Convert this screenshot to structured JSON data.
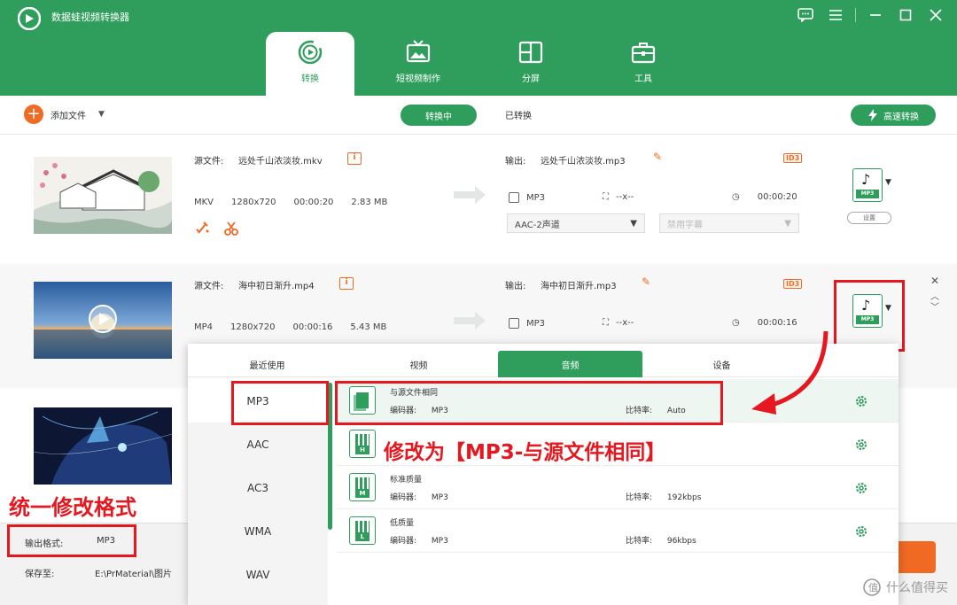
{
  "app": {
    "title": "数据蛙视频转换器",
    "brand_color": "#2f9e5c",
    "accent_color": "#f06a24",
    "window_controls": [
      "feedback-icon",
      "menu-icon",
      "minimize-icon",
      "maximize-icon",
      "close-icon"
    ]
  },
  "tabs": [
    {
      "label": "转换",
      "icon": "convert-icon",
      "active": true
    },
    {
      "label": "短视频制作",
      "icon": "tv-icon",
      "active": false
    },
    {
      "label": "分屏",
      "icon": "split-screen-icon",
      "active": false
    },
    {
      "label": "工具",
      "icon": "toolbox-icon",
      "active": false
    }
  ],
  "toolbar": {
    "add_file": "添加文件",
    "converting": "转换中",
    "converted": "已转换",
    "fast_convert": "高速转换"
  },
  "files": [
    {
      "source_label": "源文件:",
      "source_name": "远处千山浓淡妆.mkv",
      "format": "MKV",
      "resolution": "1280x720",
      "duration": "00:00:20",
      "size": "2.83 MB",
      "output_label": "输出:",
      "output_name": "远处千山浓淡妆.mp3",
      "out_format": "MP3",
      "out_resolution": "--x--",
      "out_duration": "00:00:20",
      "audio_track": "AAC-2声道",
      "subtitle": "禁用字幕",
      "settings_label": "设置"
    },
    {
      "source_label": "源文件:",
      "source_name": "海中初日渐升.mp4",
      "format": "MP4",
      "resolution": "1280x720",
      "duration": "00:00:16",
      "size": "5.43 MB",
      "output_label": "输出:",
      "output_name": "海中初日渐升.mp3",
      "out_format": "MP3",
      "out_resolution": "--x--",
      "out_duration": "00:00:16"
    }
  ],
  "id3_label": "ID3",
  "mp3_tag": "MP3",
  "popup": {
    "tabs": [
      "最近使用",
      "视频",
      "音频",
      "设备"
    ],
    "active_tab_index": 2,
    "formats": [
      "MP3",
      "AAC",
      "AC3",
      "WMA",
      "WAV"
    ],
    "presets": [
      {
        "title": "与源文件相同",
        "encoder_label": "编码器:",
        "encoder": "MP3",
        "bitrate_label": "比特率:",
        "bitrate": "Auto",
        "icon": "same-as-source-icon"
      },
      {
        "title": "",
        "encoder_label": "",
        "encoder": "",
        "bitrate_label": "",
        "bitrate": "",
        "icon": "high-quality-icon",
        "tag": "H"
      },
      {
        "title": "标准质量",
        "encoder_label": "编码器:",
        "encoder": "MP3",
        "bitrate_label": "比特率:",
        "bitrate": "192kbps",
        "icon": "standard-quality-icon",
        "tag": "M"
      },
      {
        "title": "低质量",
        "encoder_label": "编码器:",
        "encoder": "MP3",
        "bitrate_label": "比特率:",
        "bitrate": "96kbps",
        "icon": "low-quality-icon",
        "tag": "L"
      }
    ]
  },
  "bottom": {
    "output_format_label": "输出格式:",
    "output_format_value": "MP3",
    "save_to_label": "保存至:",
    "save_to_value": "E:\\PrMaterial\\图片"
  },
  "annotations": {
    "modify_note": "修改为【MP3-与源文件相同】",
    "unify_note": "统一修改格式",
    "color": "#e6171f"
  },
  "watermark": "什么值得买"
}
